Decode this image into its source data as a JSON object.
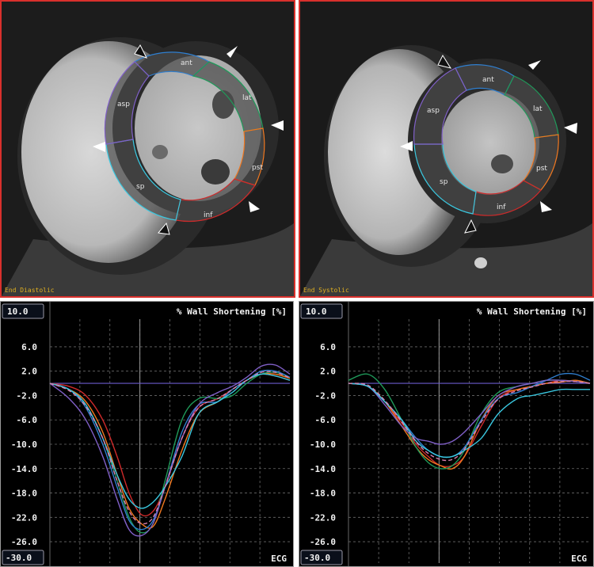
{
  "mri_panels": [
    {
      "phase_label": "End Diastolic",
      "segments": [
        "ant",
        "lat",
        "pst",
        "inf",
        "sp",
        "asp"
      ]
    },
    {
      "phase_label": "End Systolic",
      "segments": [
        "ant",
        "lat",
        "pst",
        "inf",
        "sp",
        "asp"
      ]
    }
  ],
  "colors": {
    "ant": "#2f7fd0",
    "lat": "#1f9a5a",
    "pst": "#f07820",
    "inf": "#d02a2a",
    "sp": "#3ac8e0",
    "asp": "#8060c8",
    "frame": "#d9302c",
    "baseline": "#6a5acd"
  },
  "chart_data": [
    {
      "type": "line",
      "title": "% Wall Shortening [%]",
      "ylabel": "",
      "xlabel": "ECG",
      "ylim": [
        -30,
        10
      ],
      "xlim": [
        0,
        100
      ],
      "y_max_label": "10.0",
      "y_min_label": "-30.0",
      "ytick_labels": [
        "6.0",
        "2.0",
        "-2.0",
        "-6.0",
        "-10.0",
        "-14.0",
        "-18.0",
        "-22.0",
        "-26.0"
      ],
      "yticks": [
        6,
        2,
        -2,
        -6,
        -10,
        -14,
        -18,
        -22,
        -26
      ],
      "xgrid": [
        12.5,
        25,
        37.5,
        50,
        62.5,
        75,
        87.5
      ],
      "cursor_x": 37.5,
      "grid": true,
      "series": [
        {
          "color": "#d02a2a",
          "x": [
            0,
            8,
            15,
            22,
            28,
            33,
            38,
            43,
            48,
            55,
            62,
            70,
            76,
            82,
            88,
            94,
            100
          ],
          "y": [
            0,
            -0.5,
            -2,
            -6,
            -12,
            -18,
            -21.5,
            -21,
            -17,
            -9,
            -4,
            -2.5,
            -1,
            0.5,
            1.5,
            1.2,
            0.5
          ]
        },
        {
          "color": "#f07820",
          "x": [
            0,
            8,
            15,
            22,
            28,
            33,
            38,
            43,
            48,
            55,
            62,
            70,
            76,
            82,
            88,
            94,
            100
          ],
          "y": [
            0,
            -1,
            -3,
            -8,
            -15,
            -20.5,
            -23,
            -23.5,
            -19,
            -11,
            -5,
            -3,
            -1,
            0.5,
            1.5,
            1.5,
            0.8
          ]
        },
        {
          "color": "#1f9a5a",
          "x": [
            0,
            8,
            15,
            22,
            28,
            33,
            38,
            43,
            48,
            55,
            62,
            70,
            76,
            82,
            88,
            94,
            100
          ],
          "y": [
            0,
            -1,
            -3.5,
            -9,
            -16,
            -22,
            -24.5,
            -23,
            -16,
            -6,
            -2.5,
            -2.5,
            -2,
            0,
            1.5,
            1.8,
            1
          ]
        },
        {
          "color": "#2f7fd0",
          "x": [
            0,
            8,
            15,
            22,
            28,
            33,
            38,
            43,
            48,
            55,
            62,
            70,
            76,
            82,
            88,
            94,
            100
          ],
          "y": [
            0,
            -1,
            -4,
            -10,
            -17,
            -22.5,
            -24,
            -22.5,
            -17,
            -8,
            -3.5,
            -3,
            -1,
            0.5,
            2,
            2,
            1
          ]
        },
        {
          "color": "#8060c8",
          "x": [
            0,
            8,
            15,
            22,
            28,
            33,
            38,
            43,
            48,
            55,
            62,
            70,
            76,
            82,
            88,
            94,
            100
          ],
          "y": [
            0,
            -2.5,
            -6,
            -12,
            -19,
            -24,
            -25,
            -23,
            -17,
            -9,
            -3.5,
            -1.5,
            -0.5,
            1,
            2.8,
            3,
            1.5
          ]
        },
        {
          "color": "#3ac8e0",
          "x": [
            0,
            8,
            15,
            22,
            28,
            33,
            38,
            43,
            48,
            55,
            62,
            70,
            76,
            82,
            88,
            94,
            100
          ],
          "y": [
            0,
            -1,
            -3.5,
            -9,
            -15,
            -19,
            -20.5,
            -19.5,
            -17,
            -12,
            -5,
            -3,
            -1.5,
            0.5,
            1.5,
            1.2,
            0.5
          ]
        },
        {
          "color": "#d880b0",
          "dashed": true,
          "x": [
            0,
            8,
            15,
            22,
            28,
            33,
            38,
            43,
            48,
            55,
            62,
            70,
            76,
            82,
            88,
            94,
            100
          ],
          "y": [
            0,
            -1.2,
            -3.8,
            -9,
            -16,
            -21,
            -23,
            -22,
            -17,
            -9,
            -4,
            -2.5,
            -1,
            0.5,
            1.8,
            1.8,
            0.9
          ]
        }
      ]
    },
    {
      "type": "line",
      "title": "% Wall Shortening [%]",
      "ylabel": "",
      "xlabel": "ECG",
      "ylim": [
        -30,
        10
      ],
      "xlim": [
        0,
        100
      ],
      "y_max_label": "10.0",
      "y_min_label": "-30.0",
      "ytick_labels": [
        "6.0",
        "2.0",
        "-2.0",
        "-6.0",
        "-10.0",
        "-14.0",
        "-18.0",
        "-22.0",
        "-26.0"
      ],
      "yticks": [
        6,
        2,
        -2,
        -6,
        -10,
        -14,
        -18,
        -22,
        -26
      ],
      "xgrid": [
        12.5,
        25,
        37.5,
        50,
        62.5,
        75,
        87.5
      ],
      "cursor_x": 37.5,
      "grid": true,
      "series": [
        {
          "color": "#d02a2a",
          "x": [
            0,
            8,
            15,
            22,
            28,
            33,
            38,
            43,
            48,
            55,
            62,
            70,
            76,
            82,
            88,
            94,
            100
          ],
          "y": [
            0,
            -0.5,
            -3,
            -6.5,
            -10,
            -12,
            -13.5,
            -13.5,
            -12,
            -7,
            -2.5,
            -1,
            -0.5,
            0,
            0.5,
            0.3,
            0
          ]
        },
        {
          "color": "#f07820",
          "x": [
            0,
            8,
            15,
            22,
            28,
            33,
            38,
            43,
            48,
            55,
            62,
            70,
            76,
            82,
            88,
            94,
            100
          ],
          "y": [
            0,
            -0.5,
            -3,
            -7,
            -10.5,
            -12.5,
            -13.5,
            -14,
            -12,
            -6,
            -2,
            -1,
            -0.5,
            0,
            0.2,
            0.5,
            0
          ]
        },
        {
          "color": "#1f9a5a",
          "x": [
            0,
            8,
            15,
            22,
            28,
            33,
            38,
            43,
            48,
            55,
            62,
            70,
            76,
            82,
            88,
            94,
            100
          ],
          "y": [
            0.5,
            1.5,
            -1,
            -6,
            -10.5,
            -13,
            -14,
            -13.5,
            -11,
            -5,
            -1.5,
            -0.5,
            0,
            0.5,
            0.5,
            0.3,
            0
          ]
        },
        {
          "color": "#2f7fd0",
          "x": [
            0,
            8,
            15,
            22,
            28,
            33,
            38,
            43,
            48,
            55,
            62,
            70,
            76,
            82,
            88,
            94,
            100
          ],
          "y": [
            0,
            -0.5,
            -3,
            -6,
            -9,
            -11,
            -12,
            -12,
            -10.5,
            -6,
            -2.5,
            -1.5,
            -0.5,
            0.5,
            1.5,
            1.5,
            0.5
          ]
        },
        {
          "color": "#8060c8",
          "x": [
            0,
            8,
            15,
            22,
            28,
            33,
            38,
            43,
            48,
            55,
            62,
            70,
            76,
            82,
            88,
            94,
            100
          ],
          "y": [
            0,
            -0.5,
            -3.5,
            -7,
            -9,
            -9.5,
            -10,
            -9.5,
            -8,
            -5,
            -2,
            -0.5,
            0,
            0.5,
            0.5,
            0.3,
            0
          ]
        },
        {
          "color": "#3ac8e0",
          "x": [
            0,
            8,
            15,
            22,
            28,
            33,
            38,
            43,
            48,
            55,
            62,
            70,
            76,
            82,
            88,
            94,
            100
          ],
          "y": [
            0,
            -0.5,
            -3,
            -6,
            -9.5,
            -11,
            -12,
            -12,
            -11,
            -9,
            -5,
            -2.5,
            -2,
            -1.5,
            -1,
            -1,
            -1
          ]
        },
        {
          "color": "#d880b0",
          "dashed": true,
          "x": [
            0,
            8,
            15,
            22,
            28,
            33,
            38,
            43,
            48,
            55,
            62,
            70,
            76,
            82,
            88,
            94,
            100
          ],
          "y": [
            0,
            -0.3,
            -2.8,
            -6.3,
            -9.6,
            -11.5,
            -12.5,
            -12.5,
            -10.8,
            -6.3,
            -2.6,
            -1.2,
            -0.6,
            0,
            0.3,
            0.3,
            0
          ]
        }
      ]
    }
  ]
}
